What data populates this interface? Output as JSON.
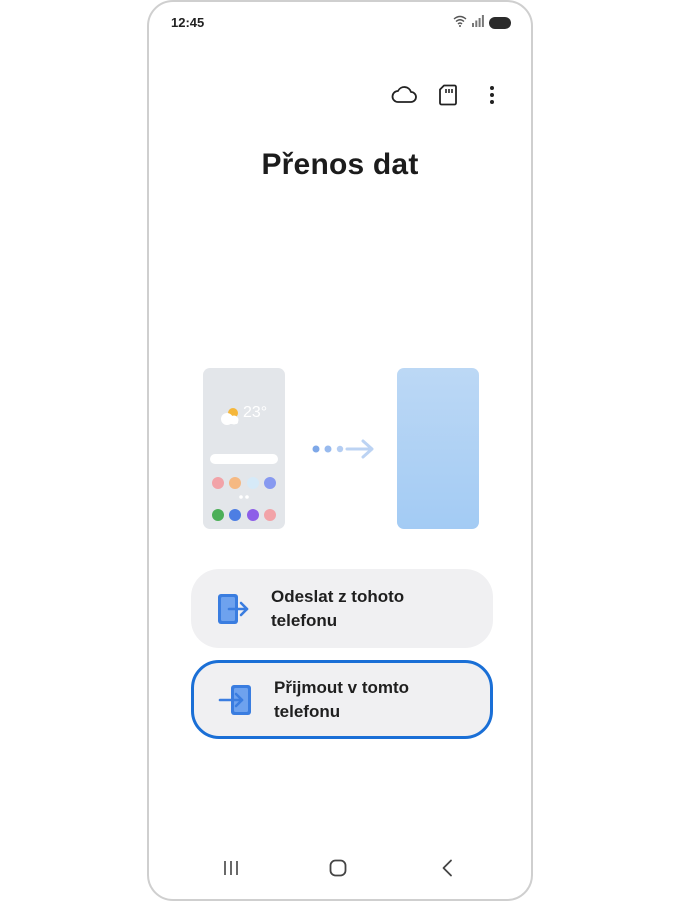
{
  "status_bar": {
    "time": "12:45",
    "icons": [
      "wifi-icon",
      "signal-icon",
      "battery-icon"
    ]
  },
  "toolbar": {
    "icons": [
      "cloud-icon",
      "sd-card-icon",
      "more-options-icon"
    ]
  },
  "page": {
    "title": "Přenos dat"
  },
  "illustration": {
    "temperature": "23°"
  },
  "actions": {
    "send_label": "Odeslat z tohoto telefonu",
    "receive_label": "Přijmout v tomto telefonu"
  },
  "nav_bar": {
    "icons": [
      "recent-apps-icon",
      "home-icon",
      "back-icon"
    ]
  },
  "colors": {
    "accent": "#1a6fd6",
    "button_bg": "#f0f0f2",
    "icon_blue": "#3a7de0"
  }
}
